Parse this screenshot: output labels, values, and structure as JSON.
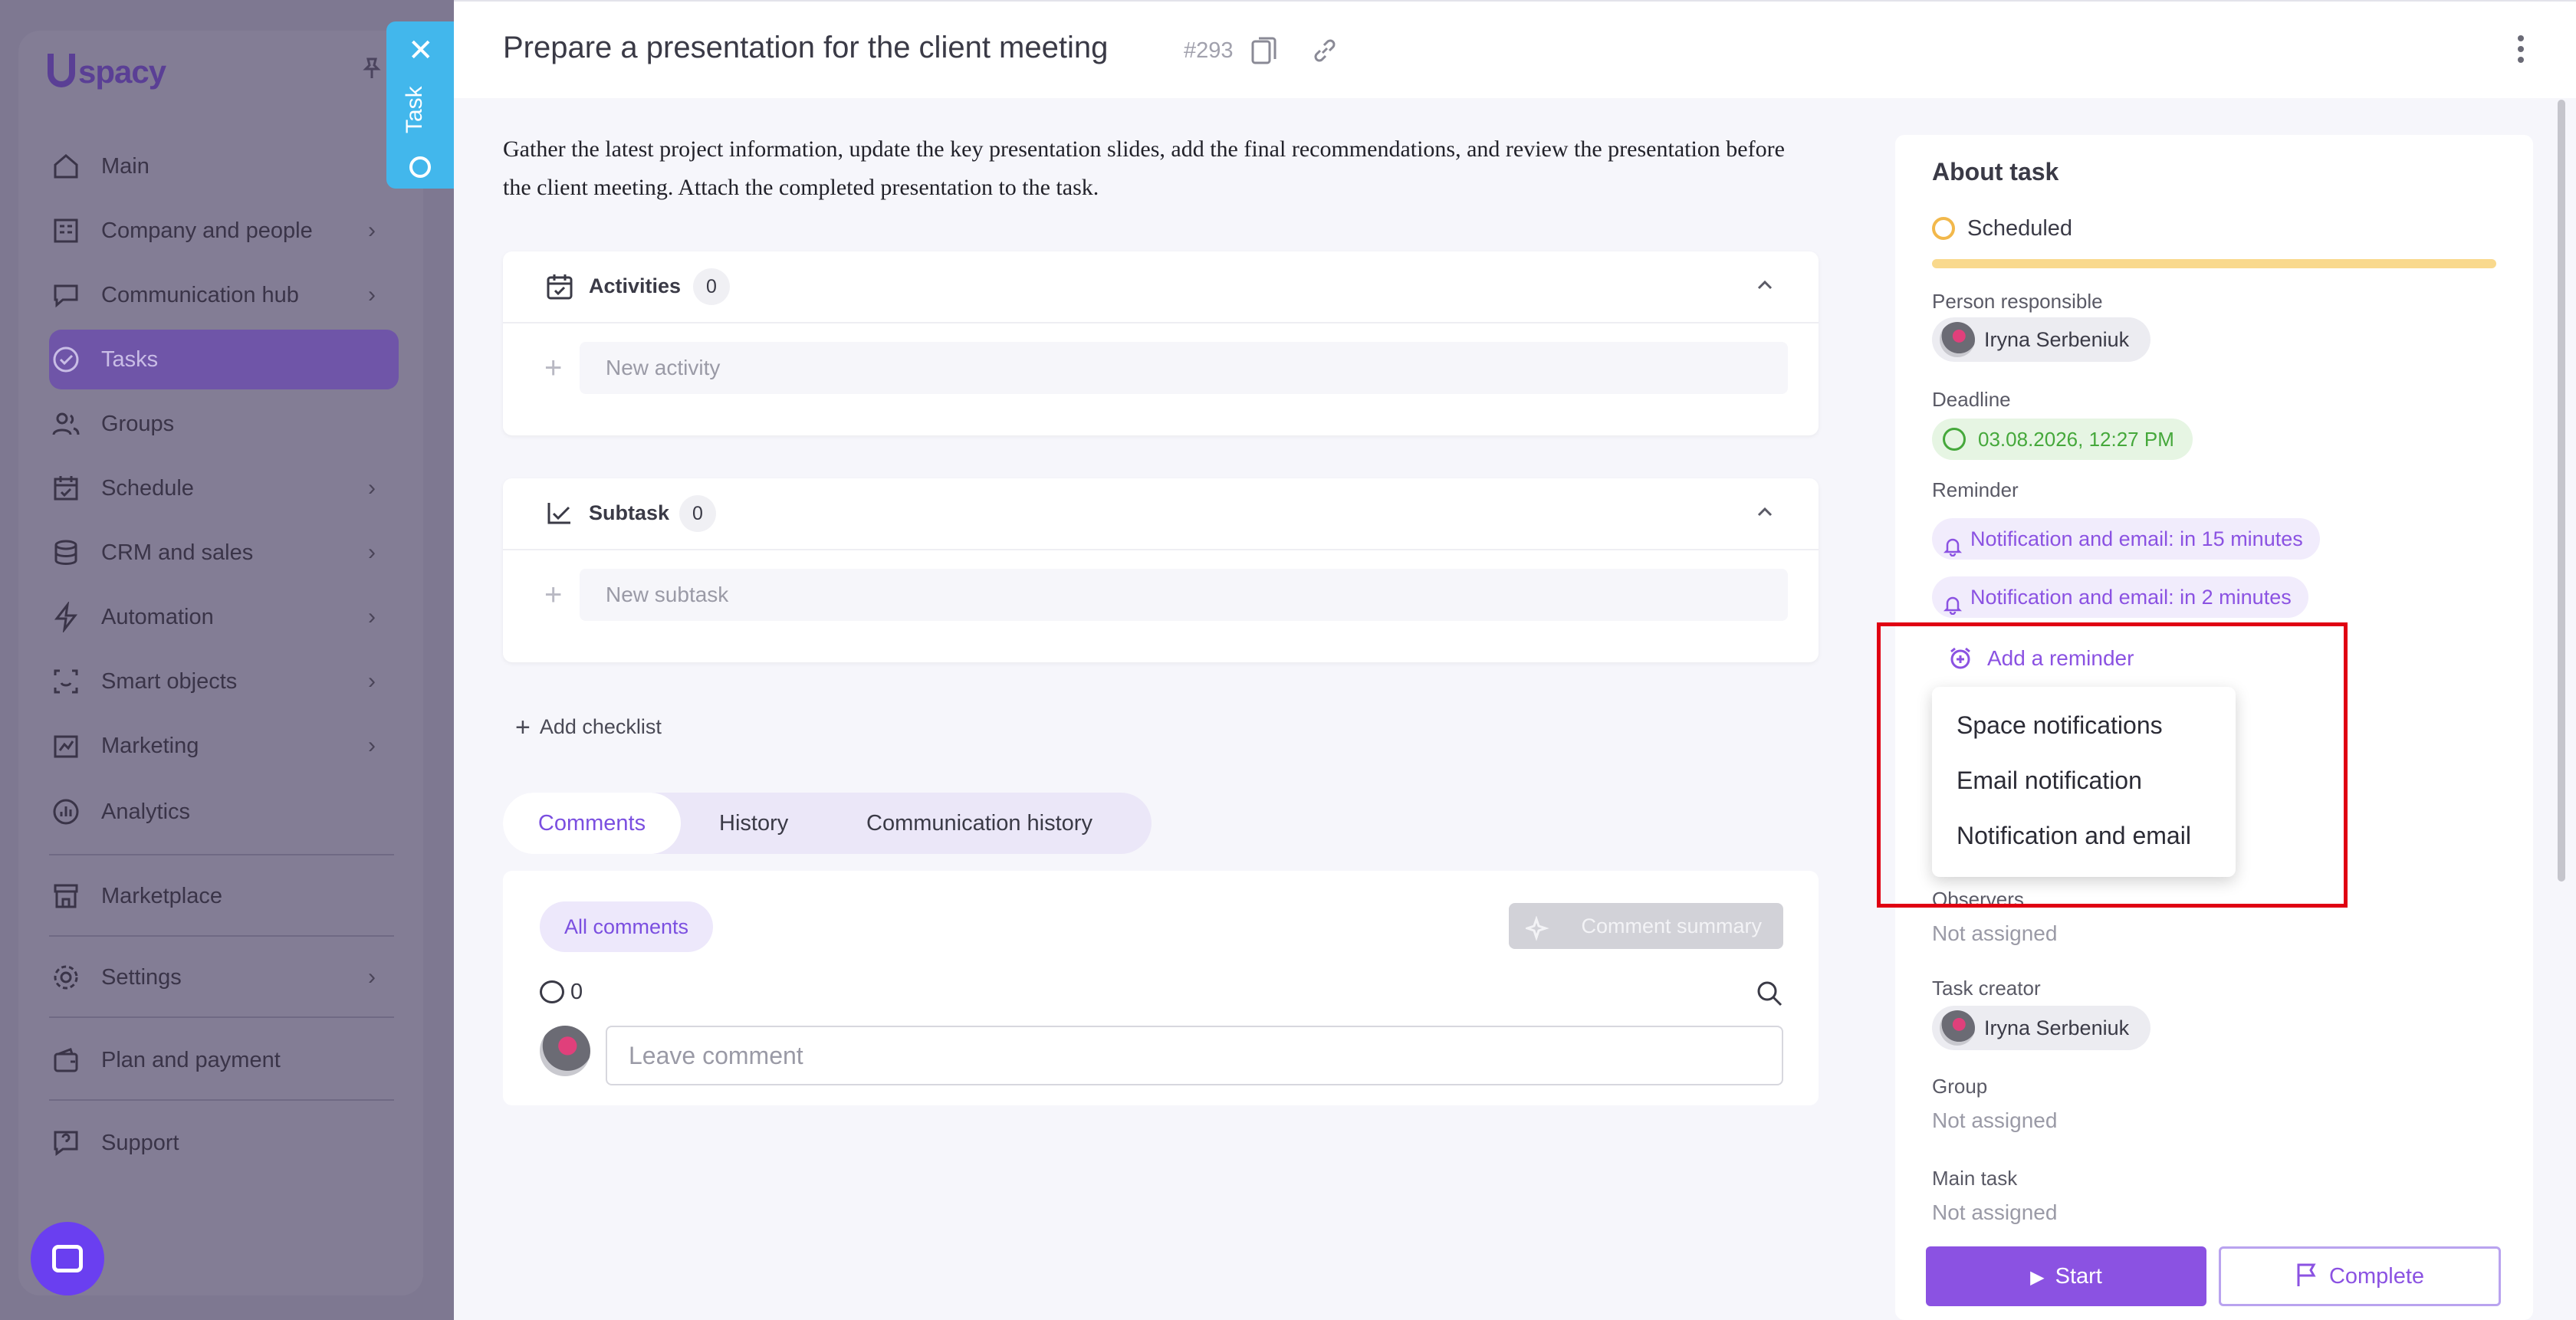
{
  "sidebar": {
    "logo": "spacy",
    "items": [
      {
        "label": "Main",
        "icon": "home-icon"
      },
      {
        "label": "Company and people",
        "icon": "building-icon",
        "chevron": true
      },
      {
        "label": "Communication hub",
        "icon": "chat-icon",
        "chevron": true
      },
      {
        "label": "Tasks",
        "icon": "check-circle-icon",
        "active": true
      },
      {
        "label": "Groups",
        "icon": "people-icon"
      },
      {
        "label": "Schedule",
        "icon": "calendar-icon",
        "chevron": true
      },
      {
        "label": "CRM and sales",
        "icon": "database-icon",
        "chevron": true
      },
      {
        "label": "Automation",
        "icon": "lightning-icon",
        "chevron": true
      },
      {
        "label": "Smart objects",
        "icon": "scan-icon",
        "chevron": true
      },
      {
        "label": "Marketing",
        "icon": "marketing-icon",
        "chevron": true
      },
      {
        "label": "Analytics",
        "icon": "chart-icon"
      },
      {
        "label": "Marketplace",
        "icon": "store-icon"
      },
      {
        "label": "Settings",
        "icon": "gear-icon",
        "chevron": true
      },
      {
        "label": "Plan and payment",
        "icon": "wallet-icon"
      },
      {
        "label": "Support",
        "icon": "help-icon"
      }
    ]
  },
  "task_tab": {
    "label": "Task"
  },
  "header": {
    "title": "Prepare a presentation for the client meeting",
    "number": "#293"
  },
  "description": "Gather the latest project information, update the key presentation slides, add the final recommendations, and review the presentation before the client meeting. Attach the completed presentation to the task.",
  "activities": {
    "title": "Activities",
    "count": "0",
    "placeholder": "New activity"
  },
  "subtask": {
    "title": "Subtask",
    "count": "0",
    "placeholder": "New subtask"
  },
  "add_checklist": "Add checklist",
  "tabs": [
    "Comments",
    "History",
    "Communication history"
  ],
  "comments": {
    "filter": "All comments",
    "summary": "Comment summary",
    "count": "0",
    "placeholder": "Leave comment"
  },
  "about": {
    "title": "About task",
    "status": "Scheduled",
    "status_color": "#f9d98d",
    "person_label": "Person responsible",
    "person": "Iryna Serbeniuk",
    "deadline_label": "Deadline",
    "deadline": "03.08.2026, 12:27 PM",
    "reminder_label": "Reminder",
    "reminders": [
      "Notification and email: in 15 minutes",
      "Notification and email: in 2 minutes"
    ],
    "add_reminder": "Add a reminder",
    "dropdown": [
      "Space notifications",
      "Email notification",
      "Notification and email"
    ],
    "observers_label": "Observers",
    "observers": "Not assigned",
    "creator_label": "Task creator",
    "creator": "Iryna Serbeniuk",
    "group_label": "Group",
    "group": "Not assigned",
    "main_task_label": "Main task",
    "main_task": "Not assigned"
  },
  "actions": {
    "start": "Start",
    "complete": "Complete"
  },
  "colors": {
    "accent": "#8b52e2",
    "highlight": "#e00012"
  }
}
